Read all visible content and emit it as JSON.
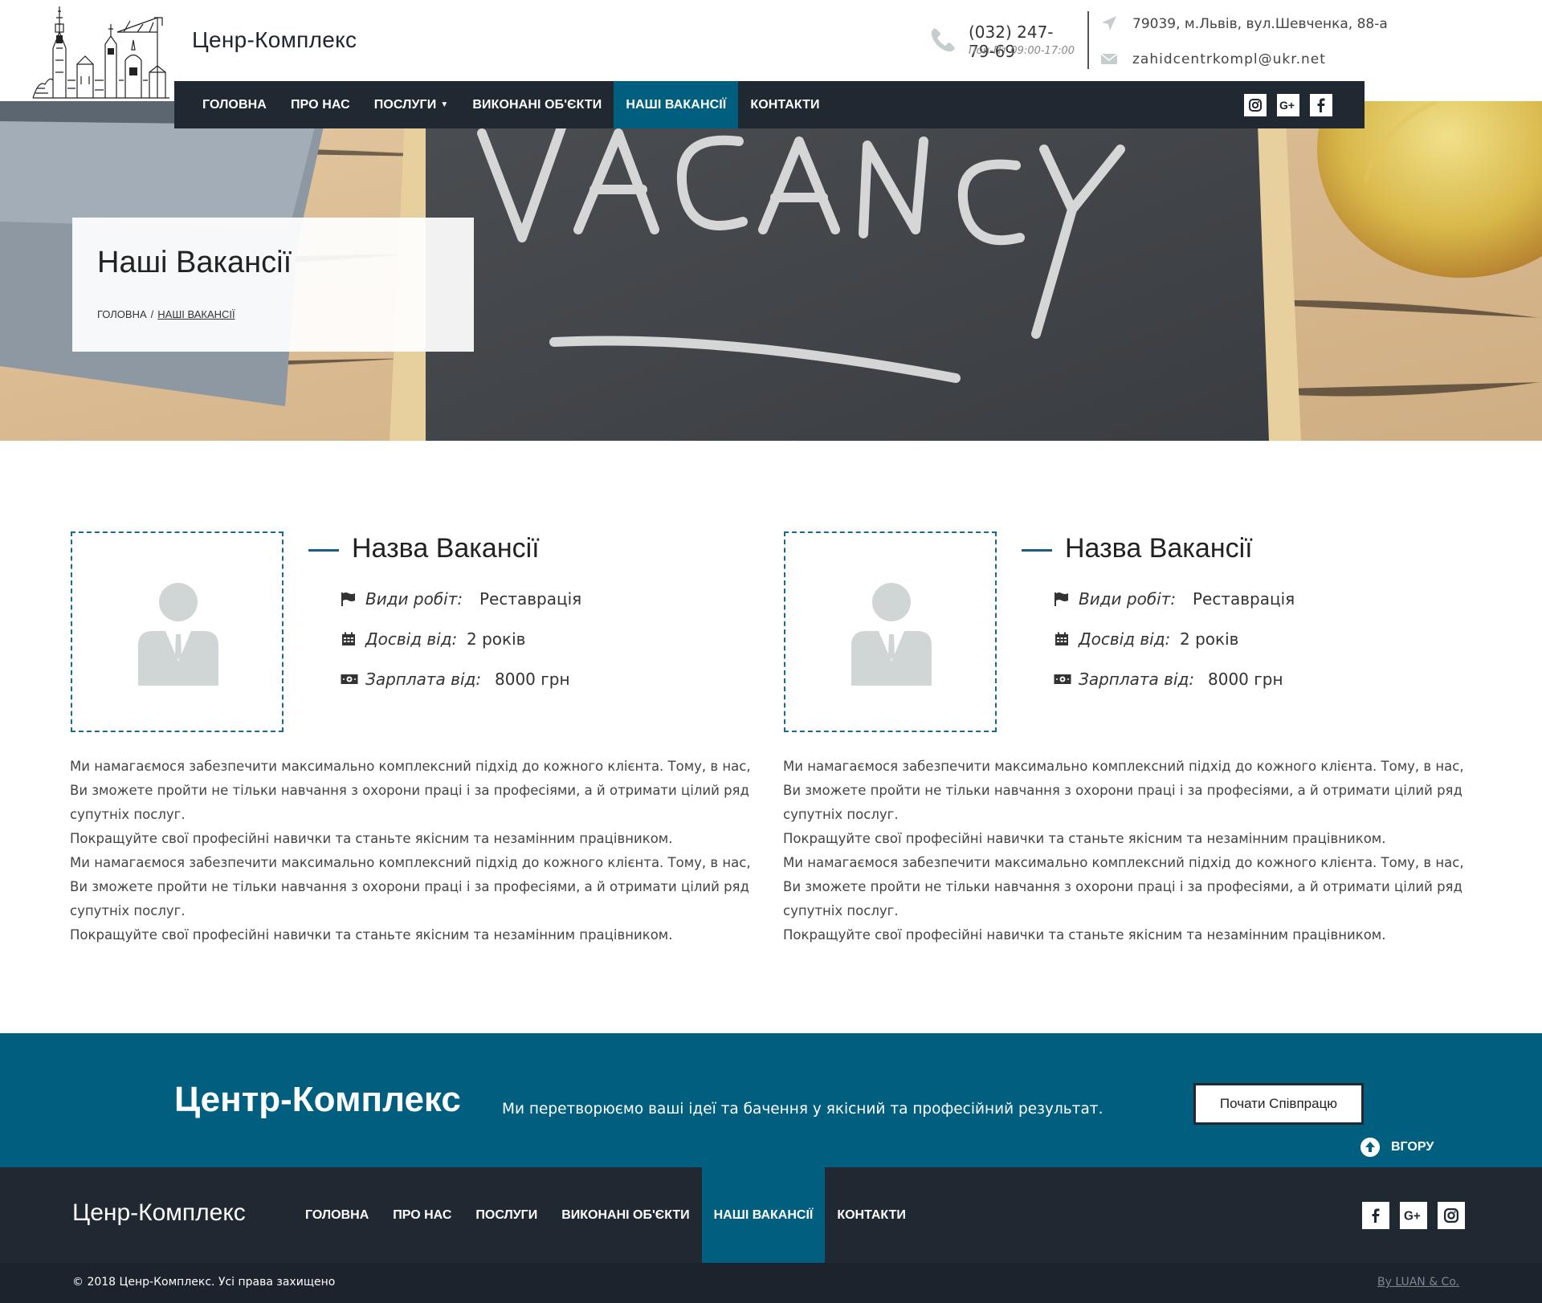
{
  "header": {
    "brand": "Ценр-Комплекс",
    "phone": "(032) 247-79-69",
    "hours": "Пон-Пт 09:00-17:00",
    "address": "79039, м.Львів, вул.Шевченка, 88-а",
    "email": "zahidcentrkompl@ukr.net"
  },
  "nav": {
    "items": [
      {
        "label": "ГОЛОВНА"
      },
      {
        "label": "ПРО НАС"
      },
      {
        "label": "ПОСЛУГИ"
      },
      {
        "label": "ВИКОНАНІ ОБ'ЄКТИ"
      },
      {
        "label": "НАШІ ВАКАНСІЇ"
      },
      {
        "label": "КОНТАКТИ"
      }
    ],
    "active_index": 4,
    "social": [
      "instagram-icon",
      "google-plus-icon",
      "facebook-icon"
    ]
  },
  "hero": {
    "title": "Наші Вакансії",
    "breadcrumb_home": "ГОЛОВНА",
    "breadcrumb_separator": "/",
    "breadcrumb_current": "НАШІ ВАКАНСІЇ",
    "image_text": "VACANCY"
  },
  "vacancies": [
    {
      "title": "Назва Вакансії",
      "work_label": "Види робіт:",
      "work_value": "Реставрація",
      "experience_label": "Досвід від:",
      "experience_value": "2 років",
      "salary_label": "Зарплата від:",
      "salary_value": "8000 грн",
      "paragraphs": [
        "Ми намагаємося забезпечити максимально комплексний підхід до кожного клієнта. Тому, в нас, Ви зможете пройти не тільки навчання з охорони праці і за професіями, а й отримати цілий ряд супутніх послуг.",
        "Покращуйте свої професійні навички та станьте якісним та незамінним працівником.",
        "Ми намагаємося забезпечити максимально комплексний підхід до кожного клієнта. Тому, в нас, Ви зможете пройти не тільки навчання з охорони праці і за професіями, а й отримати цілий ряд супутніх послуг.",
        "Покращуйте свої професійні навички та станьте якісним та незамінним працівником."
      ]
    },
    {
      "title": "Назва Вакансії",
      "work_label": "Види робіт:",
      "work_value": "Реставрація",
      "experience_label": "Досвід від:",
      "experience_value": "2 років",
      "salary_label": "Зарплата від:",
      "salary_value": "8000 грн",
      "paragraphs": [
        "Ми намагаємося забезпечити максимально комплексний підхід до кожного клієнта. Тому, в нас, Ви зможете пройти не тільки навчання з охорони праці і за професіями, а й отримати цілий ряд супутніх послуг.",
        "Покращуйте свої професійні навички та станьте якісним та незамінним працівником.",
        "Ми намагаємося забезпечити максимально комплексний підхід до кожного клієнта. Тому, в нас, Ви зможете пройти не тільки навчання з охорони праці і за професіями, а й отримати цілий ряд супутніх послуг.",
        "Покращуйте свої професійні навички та станьте якісним та незамінним працівником."
      ]
    }
  ],
  "cta": {
    "brand": "Центр-Комплекс",
    "tagline": "Ми перетворюємо ваші ідеї та бачення у якісний та професійний результат.",
    "button_label": "Почати Співпрацю",
    "to_top_label": "ВГОРУ"
  },
  "footer": {
    "brand": "Ценр-Комплекс",
    "nav": [
      {
        "label": "ГОЛОВНА"
      },
      {
        "label": "ПРО НАС"
      },
      {
        "label": "ПОСЛУГИ"
      },
      {
        "label": "ВИКОНАНІ ОБ'ЄКТИ"
      },
      {
        "label": "НАШІ ВАКАНСІЇ"
      },
      {
        "label": "КОНТАКТИ"
      }
    ],
    "active_index": 4,
    "social": [
      "facebook-icon",
      "google-plus-icon",
      "instagram-icon"
    ],
    "copyright": "© 2018 Ценр-Комплекс. Усі права захищено",
    "credit": "By LUAN & Co."
  },
  "colors": {
    "primary": "#005f7f",
    "dark": "#202832",
    "accent_line": "#1b5f7e",
    "avatar": "#d0d5d6"
  }
}
